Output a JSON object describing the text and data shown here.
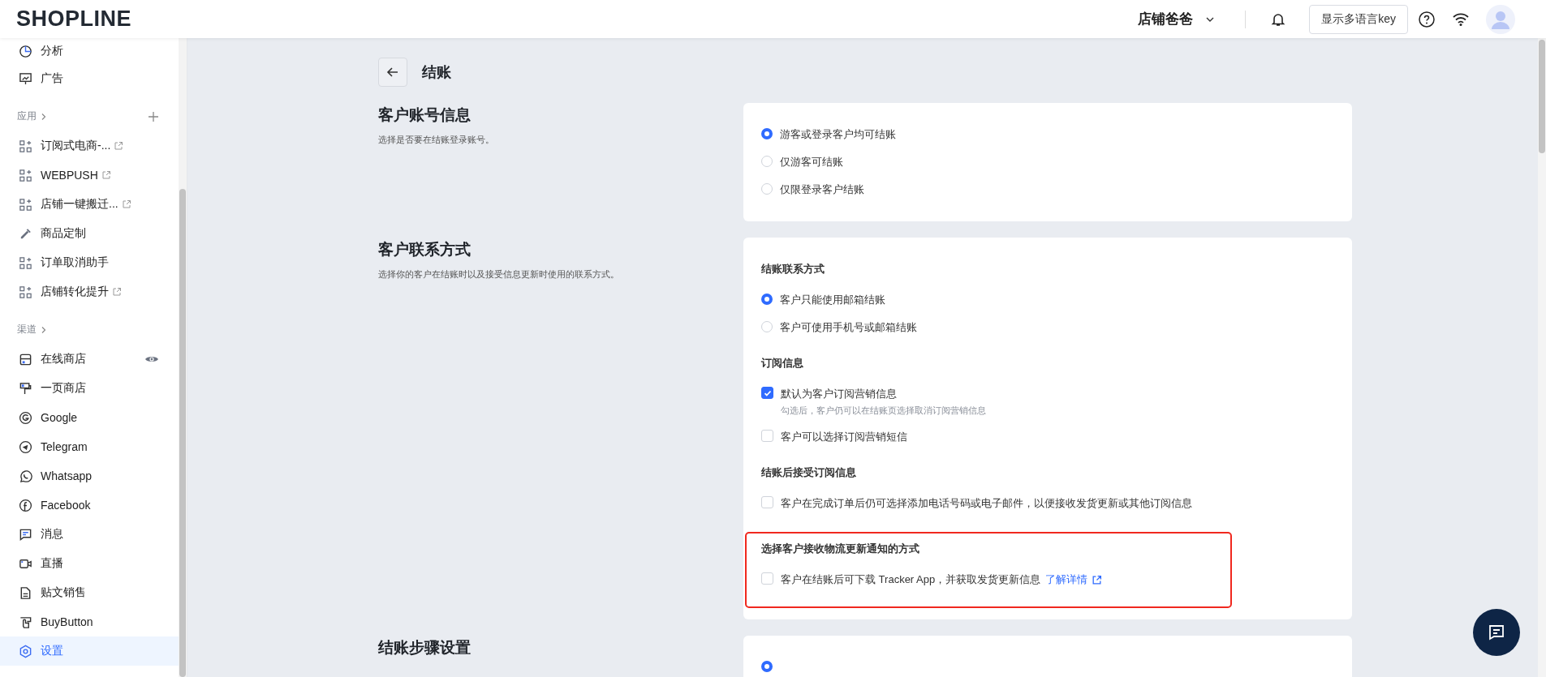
{
  "header": {
    "logo": "SHOPLINE",
    "store": "店铺爸爸",
    "lang_button": "显示多语言key"
  },
  "sidebar": {
    "groups": [
      {
        "items": [
          {
            "label": "分析",
            "external": false,
            "eye": false,
            "selected": false
          },
          {
            "label": "广告",
            "external": false,
            "eye": false,
            "selected": false
          }
        ]
      },
      {
        "title": "应用",
        "add": true,
        "items": [
          {
            "label": "订阅式电商-...",
            "external": true,
            "eye": false,
            "selected": false
          },
          {
            "label": "WEBPUSH",
            "external": true,
            "eye": false,
            "selected": false
          },
          {
            "label": "店铺一键搬迁...",
            "external": true,
            "eye": false,
            "selected": false
          },
          {
            "label": "商品定制",
            "external": false,
            "eye": false,
            "selected": false
          },
          {
            "label": "订单取消助手",
            "external": false,
            "eye": false,
            "selected": false
          },
          {
            "label": "店铺转化提升",
            "external": true,
            "eye": false,
            "selected": false
          }
        ]
      },
      {
        "title": "渠道",
        "add": false,
        "items": [
          {
            "label": "在线商店",
            "external": false,
            "eye": true,
            "selected": false
          },
          {
            "label": "一页商店",
            "external": false,
            "eye": false,
            "selected": false
          },
          {
            "label": "Google",
            "external": false,
            "eye": false,
            "selected": false
          },
          {
            "label": "Telegram",
            "external": false,
            "eye": false,
            "selected": false
          },
          {
            "label": "Whatsapp",
            "external": false,
            "eye": false,
            "selected": false
          },
          {
            "label": "Facebook",
            "external": false,
            "eye": false,
            "selected": false
          },
          {
            "label": "消息",
            "external": false,
            "eye": false,
            "selected": false
          },
          {
            "label": "直播",
            "external": false,
            "eye": false,
            "selected": false
          },
          {
            "label": "贴文销售",
            "external": false,
            "eye": false,
            "selected": false
          },
          {
            "label": "BuyButton",
            "external": false,
            "eye": false,
            "selected": false
          },
          {
            "label": "设置",
            "external": false,
            "eye": false,
            "selected": true
          }
        ]
      }
    ]
  },
  "page": {
    "title": "结账",
    "sections": [
      {
        "title": "客户账号信息",
        "description": "选择是否要在结账登录账号。",
        "groups": [
          {
            "options": [
              {
                "kind": "radio",
                "label": "游客或登录客户均可结账",
                "selected": true
              },
              {
                "kind": "radio",
                "label": "仅游客可结账",
                "selected": false
              },
              {
                "kind": "radio",
                "label": "仅限登录客户结账",
                "selected": false
              }
            ]
          }
        ]
      },
      {
        "title": "客户联系方式",
        "description": "选择你的客户在结账时以及接受信息更新时使用的联系方式。",
        "groups": [
          {
            "title": "结账联系方式",
            "highlighted": false,
            "options": [
              {
                "kind": "radio",
                "label": "客户只能使用邮箱结账",
                "selected": true
              },
              {
                "kind": "radio",
                "label": "客户可使用手机号或邮箱结账",
                "selected": false
              }
            ]
          },
          {
            "title": "订阅信息",
            "highlighted": false,
            "options": [
              {
                "kind": "checkbox",
                "label": "默认为客户订阅营销信息",
                "checked": true,
                "hint": "勾选后，客户仍可以在结账页选择取消订阅营销信息"
              },
              {
                "kind": "checkbox",
                "label": "客户可以选择订阅营销短信",
                "checked": false
              }
            ]
          },
          {
            "title": "结账后接受订阅信息",
            "highlighted": false,
            "options": [
              {
                "kind": "checkbox",
                "label": "客户在完成订单后仍可选择添加电话号码或电子邮件，以便接收发货更新或其他订阅信息",
                "checked": false
              }
            ]
          },
          {
            "title": "选择客户接收物流更新通知的方式",
            "highlighted": true,
            "options": [
              {
                "kind": "checkbox",
                "label": "客户在结账后可下载 Tracker App，并获取发货更新信息",
                "checked": false,
                "link": "了解详情"
              }
            ]
          }
        ]
      },
      {
        "title": "结账步骤设置",
        "groups": [
          {
            "options": [
              {
                "kind": "radio",
                "selected": true
              }
            ]
          }
        ]
      }
    ]
  }
}
